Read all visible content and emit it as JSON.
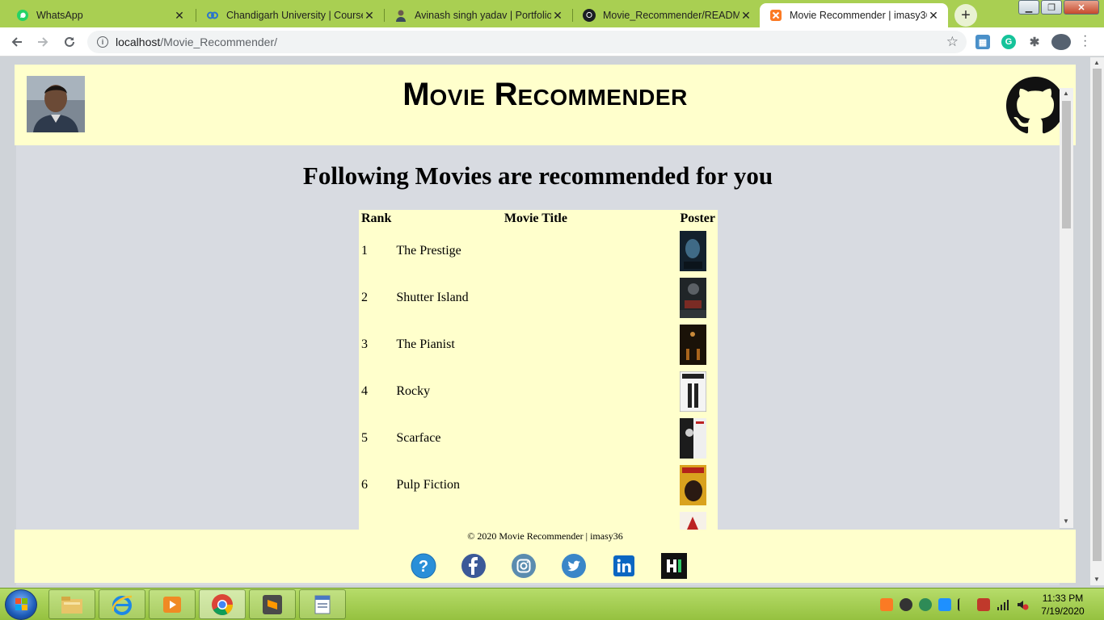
{
  "browser": {
    "tabs": [
      {
        "title": "WhatsApp",
        "icon": "whatsapp-icon",
        "active": false
      },
      {
        "title": "Chandigarh University | Coursera",
        "icon": "coursera-icon",
        "active": false
      },
      {
        "title": "Avinash singh yadav | Portfolio",
        "icon": "portfolio-icon",
        "active": false
      },
      {
        "title": "Movie_Recommender/README.md",
        "icon": "github-icon",
        "active": false
      },
      {
        "title": "Movie Recommender | imasy36",
        "icon": "xampp-icon",
        "active": true
      }
    ],
    "url": {
      "host": "localhost",
      "path": "/Movie_Recommender/"
    }
  },
  "page": {
    "header": {
      "title_first": "M",
      "title_first_rest": "ovie",
      "title_second": "R",
      "title_second_rest": "ecommender"
    },
    "heading": "Following Movies are recommended for you",
    "table": {
      "columns": [
        "Rank",
        "Movie Title",
        "Poster"
      ],
      "rows": [
        {
          "rank": "1",
          "title": "The Prestige"
        },
        {
          "rank": "2",
          "title": "Shutter Island"
        },
        {
          "rank": "3",
          "title": "The Pianist"
        },
        {
          "rank": "4",
          "title": "Rocky"
        },
        {
          "rank": "5",
          "title": "Scarface"
        },
        {
          "rank": "6",
          "title": "Pulp Fiction"
        }
      ]
    },
    "footer": {
      "copyright": "© 2020 Movie Recommender | imasy36"
    }
  },
  "taskbar": {
    "time": "11:33 PM",
    "date": "7/19/2020"
  },
  "colors": {
    "header_bg": "#ffffcc",
    "content_bg": "#d8dbe1",
    "tabstrip": "#a9cf52"
  }
}
